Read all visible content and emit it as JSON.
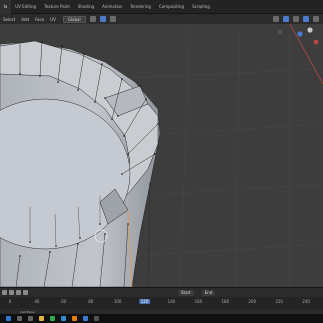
{
  "workspace_tabs": [
    "ls",
    "UV Editing",
    "Texture Paint",
    "Shading",
    "Animation",
    "Rendering",
    "Compositing",
    "Scripting"
  ],
  "active_workspace_index": 0,
  "viewport_header": {
    "menus": [
      "Select",
      "Add",
      "Face",
      "UV"
    ],
    "transform_orientation": "Global"
  },
  "timeline": {
    "frame_field": "Start",
    "end_field": "End",
    "ticks": [
      "0",
      "40",
      "60",
      "80",
      "100",
      "120",
      "140",
      "160",
      "180",
      "200",
      "220",
      "240"
    ],
    "current_frame": "120"
  },
  "statusbar": {
    "text": "Call Menu"
  },
  "colors": {
    "viewport_bg": "#3d3d3d",
    "mesh_fill": "#bfc3c9",
    "mesh_inner": "#c6cbd3",
    "accent": "#4772b3",
    "vertex": "#111111",
    "selection_edge": "#f39a38"
  },
  "taskbar_icons": [
    "windows-start-icon",
    "search-icon",
    "task-view-icon",
    "file-explorer-icon",
    "chrome-icon",
    "edge-icon",
    "blender-icon",
    "mail-icon",
    "store-icon"
  ]
}
